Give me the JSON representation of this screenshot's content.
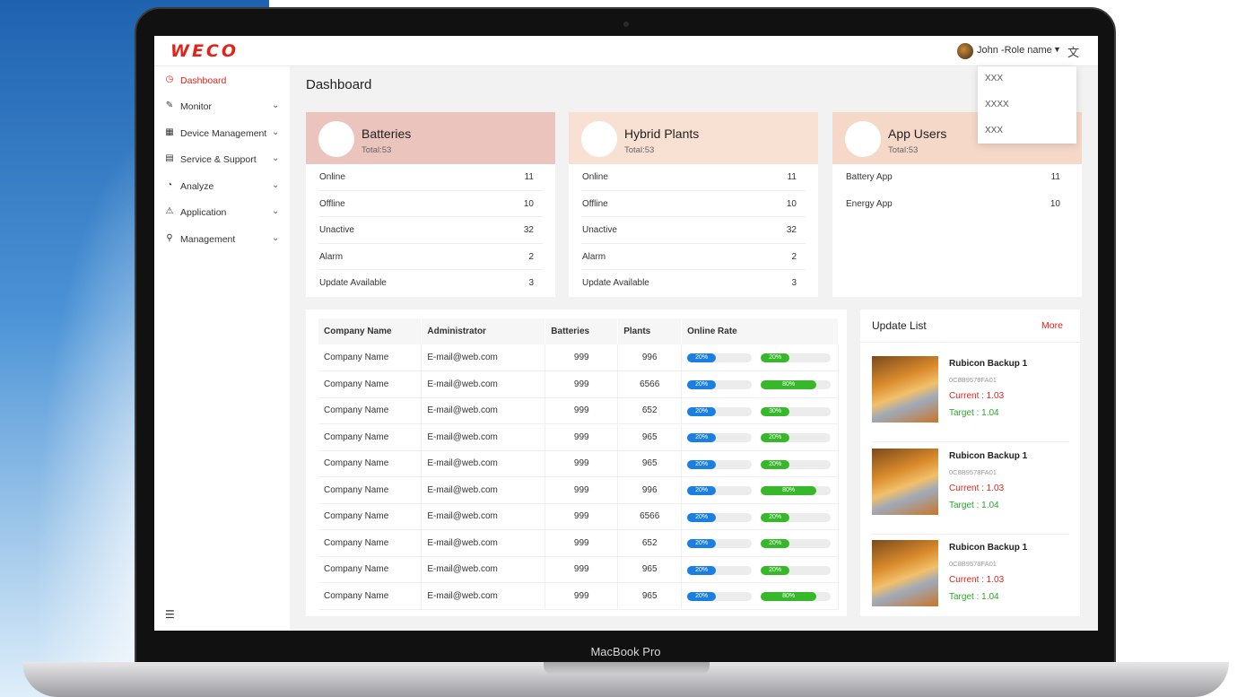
{
  "device": {
    "label": "MacBook Pro"
  },
  "header": {
    "logo": "WECO",
    "user_name": "John -Role name",
    "dropdown": [
      "XXX",
      "XXXX",
      "XXX"
    ]
  },
  "sidebar": {
    "items": [
      {
        "label": "Dashboard",
        "icon": "dashboard-icon",
        "active": true
      },
      {
        "label": "Monitor",
        "icon": "edit-icon"
      },
      {
        "label": "Device Management",
        "icon": "grid-icon"
      },
      {
        "label": "Service & Support",
        "icon": "list-icon"
      },
      {
        "label": "Analyze",
        "icon": "clock-icon"
      },
      {
        "label": "Application",
        "icon": "warning-icon"
      },
      {
        "label": "Management",
        "icon": "user-icon"
      }
    ]
  },
  "main": {
    "title": "Dashboard"
  },
  "cards": [
    {
      "title": "Batteries",
      "total": "Total:53",
      "color": "#ebc4bd",
      "rows": [
        {
          "label": "Online",
          "value": "11"
        },
        {
          "label": "Offline",
          "value": "10"
        },
        {
          "label": "Unactive",
          "value": "32"
        },
        {
          "label": "Alarm",
          "value": "2"
        },
        {
          "label": "Update Available",
          "value": "3"
        }
      ]
    },
    {
      "title": "Hybrid Plants",
      "total": "Total:53",
      "color": "#f8e0d3",
      "rows": [
        {
          "label": "Online",
          "value": "11"
        },
        {
          "label": "Offline",
          "value": "10"
        },
        {
          "label": "Unactive",
          "value": "32"
        },
        {
          "label": "Alarm",
          "value": "2"
        },
        {
          "label": "Update Available",
          "value": "3"
        }
      ]
    },
    {
      "title": "App Users",
      "total": "Total:53",
      "color": "#f6d8c8",
      "rows": [
        {
          "label": "Battery App",
          "value": "11"
        },
        {
          "label": "Energy App",
          "value": "10"
        }
      ]
    }
  ],
  "table": {
    "headers": [
      "Company Name",
      "Administrator",
      "Batteries",
      "Plants",
      "Online Rate"
    ],
    "rows": [
      {
        "company": "Company Name",
        "admin": "E-mail@web.com",
        "batteries": "999",
        "plants": "996",
        "rate1": 0.2,
        "rate1_label": "20%",
        "rate2": 0.2,
        "rate2_label": "20%"
      },
      {
        "company": "Company Name",
        "admin": "E-mail@web.com",
        "batteries": "999",
        "plants": "6566",
        "rate1": 0.2,
        "rate1_label": "20%",
        "rate2": 0.8,
        "rate2_label": "80%"
      },
      {
        "company": "Company Name",
        "admin": "E-mail@web.com",
        "batteries": "999",
        "plants": "652",
        "rate1": 0.2,
        "rate1_label": "20%",
        "rate2": 0.2,
        "rate2_label": "30%"
      },
      {
        "company": "Company Name",
        "admin": "E-mail@web.com",
        "batteries": "999",
        "plants": "965",
        "rate1": 0.2,
        "rate1_label": "20%",
        "rate2": 0.2,
        "rate2_label": "20%"
      },
      {
        "company": "Company Name",
        "admin": "E-mail@web.com",
        "batteries": "999",
        "plants": "965",
        "rate1": 0.2,
        "rate1_label": "20%",
        "rate2": 0.2,
        "rate2_label": "20%"
      },
      {
        "company": "Company Name",
        "admin": "E-mail@web.com",
        "batteries": "999",
        "plants": "996",
        "rate1": 0.2,
        "rate1_label": "20%",
        "rate2": 0.8,
        "rate2_label": "80%"
      },
      {
        "company": "Company Name",
        "admin": "E-mail@web.com",
        "batteries": "999",
        "plants": "6566",
        "rate1": 0.2,
        "rate1_label": "20%",
        "rate2": 0.2,
        "rate2_label": "20%"
      },
      {
        "company": "Company Name",
        "admin": "E-mail@web.com",
        "batteries": "999",
        "plants": "652",
        "rate1": 0.2,
        "rate1_label": "20%",
        "rate2": 0.2,
        "rate2_label": "20%"
      },
      {
        "company": "Company Name",
        "admin": "E-mail@web.com",
        "batteries": "999",
        "plants": "965",
        "rate1": 0.2,
        "rate1_label": "20%",
        "rate2": 0.2,
        "rate2_label": "20%"
      },
      {
        "company": "Company Name",
        "admin": "E-mail@web.com",
        "batteries": "999",
        "plants": "965",
        "rate1": 0.2,
        "rate1_label": "20%",
        "rate2": 0.8,
        "rate2_label": "80%"
      }
    ]
  },
  "updates": {
    "title": "Update List",
    "more": "More",
    "items": [
      {
        "name": "Rubicon Backup 1",
        "id": "0C8B9578FA01",
        "current": "Current : 1.03",
        "target": "Target : 1.04"
      },
      {
        "name": "Rubicon Backup 1",
        "id": "0C8B9578FA01",
        "current": "Current : 1.03",
        "target": "Target : 1.04"
      },
      {
        "name": "Rubicon Backup 1",
        "id": "0C8B9578FA01",
        "current": "Current : 1.03",
        "target": "Target : 1.04"
      }
    ]
  },
  "colors": {
    "accent": "#e2231a",
    "blue_bar": "#1a7fe0",
    "green_bar": "#36b82a"
  }
}
